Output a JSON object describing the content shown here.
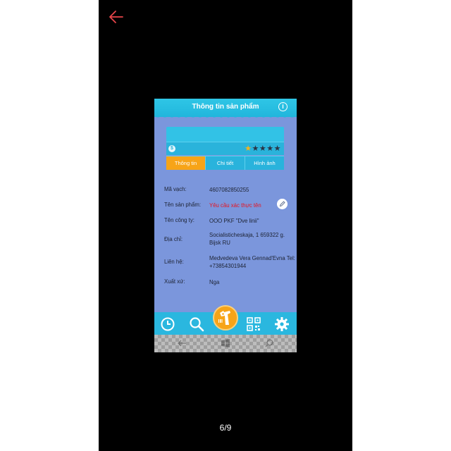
{
  "header": {
    "title": "Thông tin sản phẩm",
    "info_icon": "i"
  },
  "card": {
    "coin_icon": "$",
    "rating": {
      "value": 1,
      "max": 5
    },
    "tabs": [
      {
        "label": "Thông tin",
        "active": true
      },
      {
        "label": "Chi tiết",
        "active": false
      },
      {
        "label": "Hình ảnh",
        "active": false
      }
    ]
  },
  "fields": [
    {
      "label": "Mã vạch:",
      "value": "4607082850255"
    },
    {
      "label": "Tên sản phẩm:",
      "value": "Yêu cầu xác thực tên"
    },
    {
      "label": "Tên công ty:",
      "value": "OOO PKF \"Dve linii\""
    },
    {
      "label": "Địa chỉ:",
      "value": "Socialisticheskaja, 1 659322 g. Bijsk RU"
    },
    {
      "label": "Liên hệ:",
      "value": "Medvedeva Vera Gennad'Evna Tel: +73854301944"
    },
    {
      "label": "Xuất xứ:",
      "value": "Nga"
    }
  ],
  "bottom_nav": {
    "icons": [
      "history-icon",
      "search-icon",
      "scan-barcode-icon",
      "qr-code-icon",
      "settings-icon"
    ]
  },
  "pager": {
    "text": "6/9"
  },
  "colors": {
    "accent": "#f7a418",
    "bar": "#2ab7df",
    "background": "#7b96dc",
    "warning": "#e8131f"
  }
}
